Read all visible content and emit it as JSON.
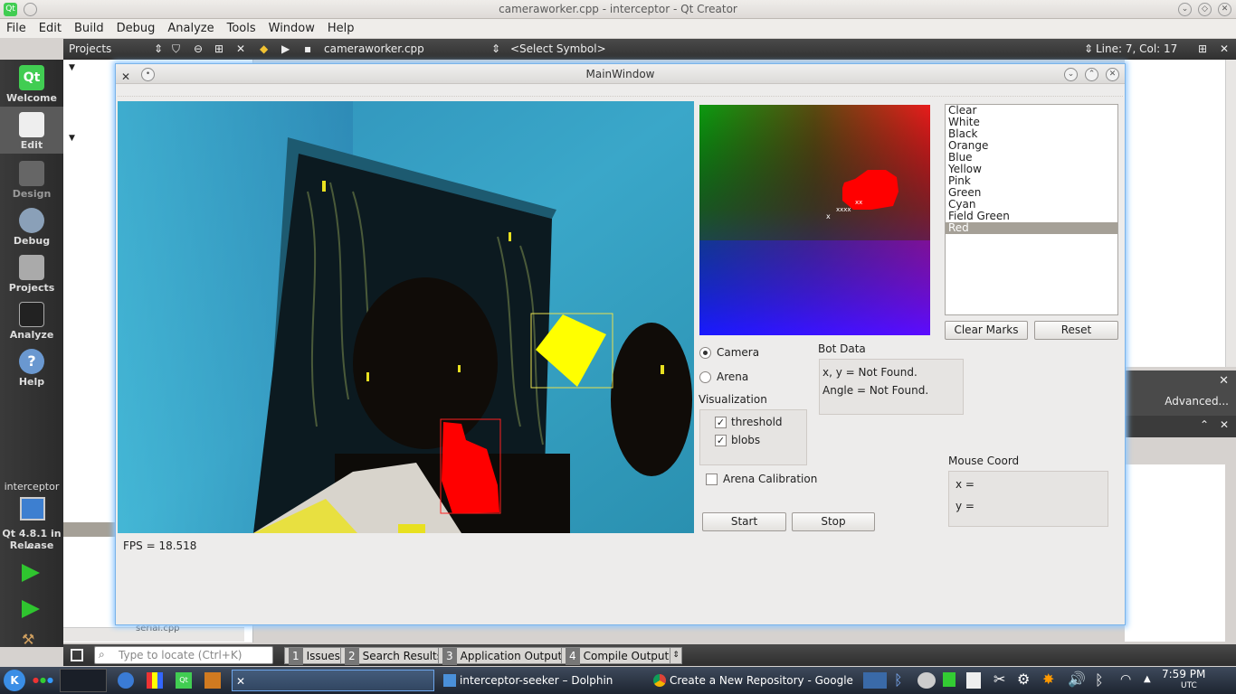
{
  "app": {
    "window_title": "cameraworker.cpp - interceptor - Qt Creator",
    "menu": [
      "File",
      "Edit",
      "Build",
      "Debug",
      "Analyze",
      "Tools",
      "Window",
      "Help"
    ],
    "toolbar": {
      "projects_label": "Projects",
      "file_name": "cameraworker.cpp",
      "symbol_placeholder": "<Select Symbol>",
      "cursor_pos": "Line: 7, Col: 17"
    },
    "modes": [
      "Welcome",
      "Edit",
      "Design",
      "Debug",
      "Projects",
      "Analyze",
      "Help"
    ],
    "kit": {
      "project": "interceptor",
      "qt_version": "Qt 4.8.1 in ...",
      "build": "Release"
    },
    "find": {
      "advanced": "Advanced..."
    },
    "locator_placeholder": "Type to locate (Ctrl+K)",
    "output_tabs": [
      {
        "num": "1",
        "label": "Issues"
      },
      {
        "num": "2",
        "label": "Search Results"
      },
      {
        "num": "3",
        "label": "Application Output"
      },
      {
        "num": "4",
        "label": "Compile Output"
      }
    ],
    "partial_file": "serial.cpp"
  },
  "mainwindow": {
    "title": "MainWindow",
    "fps": "FPS = 18.518",
    "color_list": [
      "Clear",
      "White",
      "Black",
      "Orange",
      "Blue",
      "Yellow",
      "Pink",
      "Green",
      "Cyan",
      "Field Green",
      "Red"
    ],
    "selected_color": "Red",
    "clear_marks": "Clear Marks",
    "reset": "Reset",
    "source": {
      "camera": "Camera",
      "arena": "Arena",
      "selected": "Camera"
    },
    "bot_data": {
      "label": "Bot Data",
      "xy": "x, y = Not Found.",
      "angle": "Angle = Not Found."
    },
    "visualization": {
      "label": "Visualization",
      "threshold": "threshold",
      "blobs": "blobs",
      "threshold_checked": true,
      "blobs_checked": true
    },
    "arena_calibration": "Arena Calibration",
    "start": "Start",
    "stop": "Stop",
    "mouse": {
      "label": "Mouse Coord",
      "x": "x =",
      "y": "y ="
    },
    "colors": {
      "yellow_blob": "#ffff00",
      "red_blob": "#ff0000",
      "selection_border": "#e8e050"
    }
  },
  "taskbar": {
    "items": [
      "interceptor-seeker – Dolphin",
      "Create a New Repository - Google Ch"
    ],
    "clock": "7:59 PM",
    "tz": "UTC"
  }
}
